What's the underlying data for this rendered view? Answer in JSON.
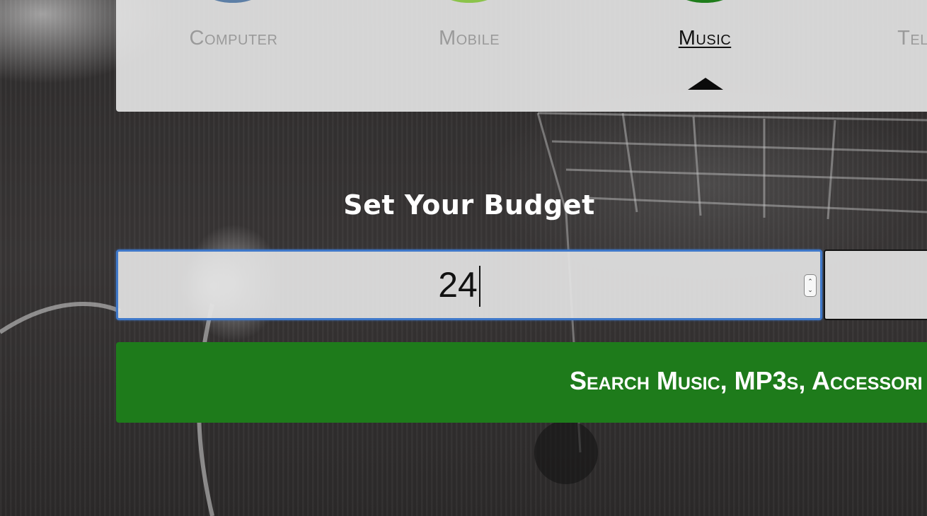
{
  "categories": [
    {
      "label": "Computer",
      "color": "#5d7fa6",
      "active": false
    },
    {
      "label": "Mobile",
      "color": "#8bc34a",
      "active": false
    },
    {
      "label": "Music",
      "color": "#1f7d1b",
      "active": true
    },
    {
      "label": "Tel",
      "color": "#c7c7c7",
      "active": false
    }
  ],
  "budget": {
    "heading": "Set Your Budget",
    "value": "24",
    "stepper_up": "⌃",
    "stepper_down": "⌄"
  },
  "search": {
    "label": "Search Music, MP3s, Accessori"
  },
  "colors": {
    "accent_green": "#1e7b1b",
    "focus_blue": "#3f78c9"
  }
}
